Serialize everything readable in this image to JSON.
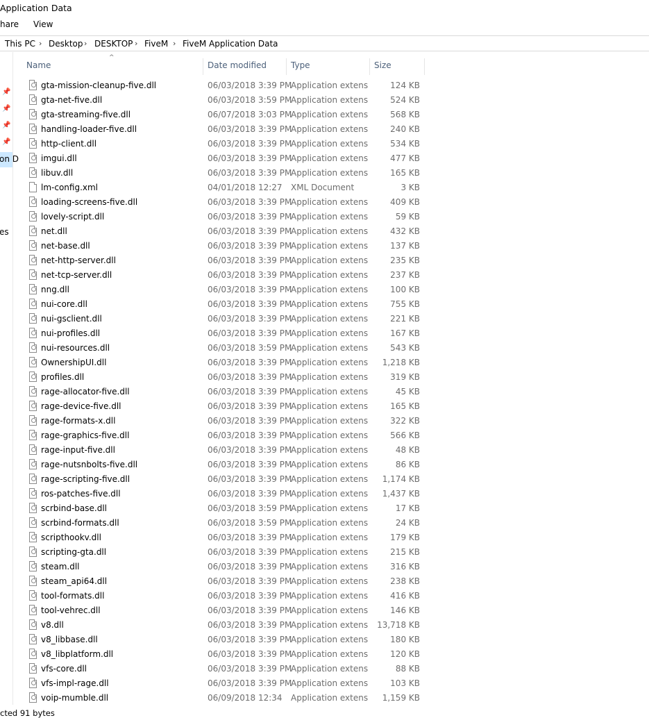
{
  "window": {
    "title": "Application Data"
  },
  "ribbon": {
    "tabs": [
      "hare",
      "View"
    ]
  },
  "breadcrumb": {
    "items": [
      "This PC",
      "Desktop",
      "DESKTOP",
      "FiveM",
      "FiveM Application Data"
    ]
  },
  "nav_pane": {
    "selected_label": "on D",
    "other_label": "es"
  },
  "columns": {
    "name": "Name",
    "date": "Date modified",
    "type": "Type",
    "size": "Size"
  },
  "files": [
    {
      "name": "gta-mission-cleanup-five.dll",
      "date": "06/03/2018 3:39 PM",
      "type": "Application extens",
      "size": "124 KB",
      "icon": "dll-file-icon"
    },
    {
      "name": "gta-net-five.dll",
      "date": "06/03/2018 3:59 PM",
      "type": "Application extens",
      "size": "524 KB",
      "icon": "dll-file-icon"
    },
    {
      "name": "gta-streaming-five.dll",
      "date": "06/07/2018 3:03 PM",
      "type": "Application extens",
      "size": "568 KB",
      "icon": "dll-file-icon"
    },
    {
      "name": "handling-loader-five.dll",
      "date": "06/03/2018 3:39 PM",
      "type": "Application extens",
      "size": "240 KB",
      "icon": "dll-file-icon"
    },
    {
      "name": "http-client.dll",
      "date": "06/03/2018 3:39 PM",
      "type": "Application extens",
      "size": "534 KB",
      "icon": "dll-file-icon"
    },
    {
      "name": "imgui.dll",
      "date": "06/03/2018 3:39 PM",
      "type": "Application extens",
      "size": "477 KB",
      "icon": "dll-file-icon"
    },
    {
      "name": "libuv.dll",
      "date": "06/03/2018 3:39 PM",
      "type": "Application extens",
      "size": "165 KB",
      "icon": "dll-file-icon"
    },
    {
      "name": "lm-config.xml",
      "date": "04/01/2018 12:27",
      "type": "XML Document",
      "size": "3 KB",
      "icon": "xml-file-icon"
    },
    {
      "name": "loading-screens-five.dll",
      "date": "06/03/2018 3:39 PM",
      "type": "Application extens",
      "size": "409 KB",
      "icon": "dll-file-icon"
    },
    {
      "name": "lovely-script.dll",
      "date": "06/03/2018 3:39 PM",
      "type": "Application extens",
      "size": "59 KB",
      "icon": "dll-file-icon"
    },
    {
      "name": "net.dll",
      "date": "06/03/2018 3:39 PM",
      "type": "Application extens",
      "size": "432 KB",
      "icon": "dll-file-icon"
    },
    {
      "name": "net-base.dll",
      "date": "06/03/2018 3:39 PM",
      "type": "Application extens",
      "size": "137 KB",
      "icon": "dll-file-icon"
    },
    {
      "name": "net-http-server.dll",
      "date": "06/03/2018 3:39 PM",
      "type": "Application extens",
      "size": "235 KB",
      "icon": "dll-file-icon"
    },
    {
      "name": "net-tcp-server.dll",
      "date": "06/03/2018 3:39 PM",
      "type": "Application extens",
      "size": "237 KB",
      "icon": "dll-file-icon"
    },
    {
      "name": "nng.dll",
      "date": "06/03/2018 3:39 PM",
      "type": "Application extens",
      "size": "100 KB",
      "icon": "dll-file-icon"
    },
    {
      "name": "nui-core.dll",
      "date": "06/03/2018 3:39 PM",
      "type": "Application extens",
      "size": "755 KB",
      "icon": "dll-file-icon"
    },
    {
      "name": "nui-gsclient.dll",
      "date": "06/03/2018 3:39 PM",
      "type": "Application extens",
      "size": "221 KB",
      "icon": "dll-file-icon"
    },
    {
      "name": "nui-profiles.dll",
      "date": "06/03/2018 3:39 PM",
      "type": "Application extens",
      "size": "167 KB",
      "icon": "dll-file-icon"
    },
    {
      "name": "nui-resources.dll",
      "date": "06/03/2018 3:59 PM",
      "type": "Application extens",
      "size": "543 KB",
      "icon": "dll-file-icon"
    },
    {
      "name": "OwnershipUI.dll",
      "date": "06/03/2018 3:39 PM",
      "type": "Application extens",
      "size": "1,218 KB",
      "icon": "dll-file-icon"
    },
    {
      "name": "profiles.dll",
      "date": "06/03/2018 3:39 PM",
      "type": "Application extens",
      "size": "319 KB",
      "icon": "dll-file-icon"
    },
    {
      "name": "rage-allocator-five.dll",
      "date": "06/03/2018 3:39 PM",
      "type": "Application extens",
      "size": "45 KB",
      "icon": "dll-file-icon"
    },
    {
      "name": "rage-device-five.dll",
      "date": "06/03/2018 3:39 PM",
      "type": "Application extens",
      "size": "165 KB",
      "icon": "dll-file-icon"
    },
    {
      "name": "rage-formats-x.dll",
      "date": "06/03/2018 3:39 PM",
      "type": "Application extens",
      "size": "322 KB",
      "icon": "dll-file-icon"
    },
    {
      "name": "rage-graphics-five.dll",
      "date": "06/03/2018 3:39 PM",
      "type": "Application extens",
      "size": "566 KB",
      "icon": "dll-file-icon"
    },
    {
      "name": "rage-input-five.dll",
      "date": "06/03/2018 3:39 PM",
      "type": "Application extens",
      "size": "48 KB",
      "icon": "dll-file-icon"
    },
    {
      "name": "rage-nutsnbolts-five.dll",
      "date": "06/03/2018 3:39 PM",
      "type": "Application extens",
      "size": "86 KB",
      "icon": "dll-file-icon"
    },
    {
      "name": "rage-scripting-five.dll",
      "date": "06/03/2018 3:39 PM",
      "type": "Application extens",
      "size": "1,174 KB",
      "icon": "dll-file-icon"
    },
    {
      "name": "ros-patches-five.dll",
      "date": "06/03/2018 3:39 PM",
      "type": "Application extens",
      "size": "1,437 KB",
      "icon": "dll-file-icon"
    },
    {
      "name": "scrbind-base.dll",
      "date": "06/03/2018 3:59 PM",
      "type": "Application extens",
      "size": "17 KB",
      "icon": "dll-file-icon"
    },
    {
      "name": "scrbind-formats.dll",
      "date": "06/03/2018 3:59 PM",
      "type": "Application extens",
      "size": "24 KB",
      "icon": "dll-file-icon"
    },
    {
      "name": "scripthookv.dll",
      "date": "06/03/2018 3:39 PM",
      "type": "Application extens",
      "size": "179 KB",
      "icon": "dll-file-icon"
    },
    {
      "name": "scripting-gta.dll",
      "date": "06/03/2018 3:39 PM",
      "type": "Application extens",
      "size": "215 KB",
      "icon": "dll-file-icon"
    },
    {
      "name": "steam.dll",
      "date": "06/03/2018 3:39 PM",
      "type": "Application extens",
      "size": "316 KB",
      "icon": "dll-file-icon"
    },
    {
      "name": "steam_api64.dll",
      "date": "06/03/2018 3:39 PM",
      "type": "Application extens",
      "size": "238 KB",
      "icon": "dll-file-icon"
    },
    {
      "name": "tool-formats.dll",
      "date": "06/03/2018 3:39 PM",
      "type": "Application extens",
      "size": "416 KB",
      "icon": "dll-file-icon"
    },
    {
      "name": "tool-vehrec.dll",
      "date": "06/03/2018 3:39 PM",
      "type": "Application extens",
      "size": "146 KB",
      "icon": "dll-file-icon"
    },
    {
      "name": "v8.dll",
      "date": "06/03/2018 3:39 PM",
      "type": "Application extens",
      "size": "13,718 KB",
      "icon": "dll-file-icon"
    },
    {
      "name": "v8_libbase.dll",
      "date": "06/03/2018 3:39 PM",
      "type": "Application extens",
      "size": "180 KB",
      "icon": "dll-file-icon"
    },
    {
      "name": "v8_libplatform.dll",
      "date": "06/03/2018 3:39 PM",
      "type": "Application extens",
      "size": "120 KB",
      "icon": "dll-file-icon"
    },
    {
      "name": "vfs-core.dll",
      "date": "06/03/2018 3:39 PM",
      "type": "Application extens",
      "size": "88 KB",
      "icon": "dll-file-icon"
    },
    {
      "name": "vfs-impl-rage.dll",
      "date": "06/03/2018 3:39 PM",
      "type": "Application extens",
      "size": "103 KB",
      "icon": "dll-file-icon"
    },
    {
      "name": "voip-mumble.dll",
      "date": "06/09/2018 12:34",
      "type": "Application extens",
      "size": "1,159 KB",
      "icon": "dll-file-icon"
    }
  ],
  "status": {
    "text": "cted  91 bytes"
  },
  "colors": {
    "header_text": "#4c607a",
    "detail_text": "#6d6d6d",
    "nav_selected": "#cce8ff"
  }
}
